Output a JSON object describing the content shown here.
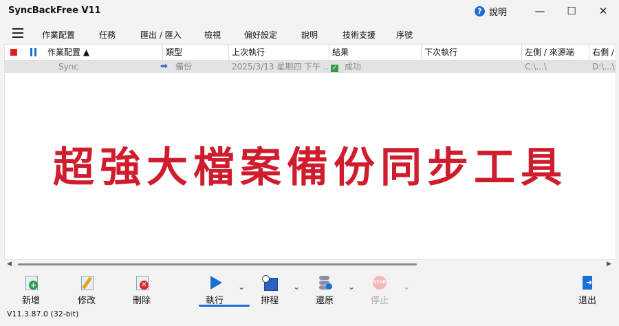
{
  "window": {
    "title": "SyncBackFree V11",
    "help_label": "說明",
    "controls": [
      "—",
      "☐",
      "✕"
    ]
  },
  "menu": [
    "作業配置",
    "任務",
    "匯出 / 匯入",
    "檢視",
    "偏好設定",
    "說明",
    "技術支援",
    "序號"
  ],
  "table": {
    "columns": [
      "作業配置 ▲",
      "類型",
      "上次執行",
      "結果",
      "下次執行",
      "左側 / 來源端",
      "右側 /"
    ],
    "rows": [
      {
        "profile": "Sync",
        "type": "備份",
        "last_run": "2025/3/13 星期四 下午 ...",
        "result": "成功",
        "next_run": "",
        "left": "C:\\...\\",
        "right": "D:\\...\\"
      }
    ]
  },
  "banner": "超強大檔案備份同步工具",
  "toolbar": {
    "new": "新增",
    "edit": "修改",
    "delete": "刪除",
    "run": "執行",
    "schedule": "排程",
    "restore": "還原",
    "stop": "停止",
    "exit": "退出"
  },
  "status": {
    "version": "V11.3.87.0 (32-bit)"
  },
  "colors": {
    "accent": "#1a6fd6",
    "banner": "#cf1d2d",
    "stop_red": "#e21f1f",
    "success_green": "#2e9d4a"
  }
}
